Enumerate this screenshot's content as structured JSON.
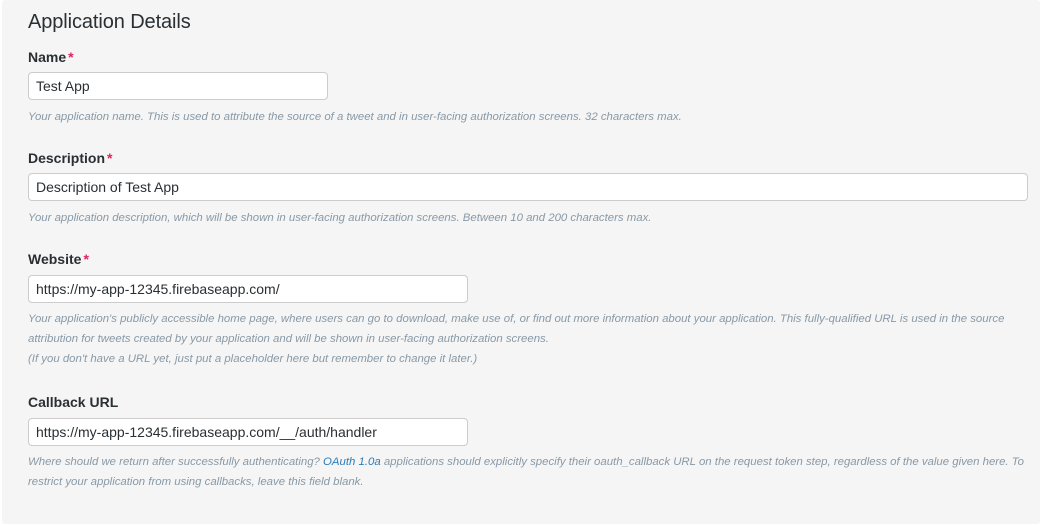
{
  "section": {
    "title": "Application Details"
  },
  "fields": {
    "name": {
      "label": "Name",
      "required_mark": "*",
      "value": "Test App",
      "help": "Your application name. This is used to attribute the source of a tweet and in user-facing authorization screens. 32 characters max."
    },
    "description": {
      "label": "Description",
      "required_mark": "*",
      "value": "Description of Test App",
      "help": "Your application description, which will be shown in user-facing authorization screens. Between 10 and 200 characters max."
    },
    "website": {
      "label": "Website",
      "required_mark": "*",
      "value": "https://my-app-12345.firebaseapp.com/",
      "help_line1": "Your application's publicly accessible home page, where users can go to download, make use of, or find out more information about your application. This fully-qualified URL is used in the source attribution for tweets created by your application and will be shown in user-facing authorization screens.",
      "help_line2": "(If you don't have a URL yet, just put a placeholder here but remember to change it later.)"
    },
    "callback": {
      "label": "Callback URL",
      "value": "https://my-app-12345.firebaseapp.com/__/auth/handler",
      "help_before_link": "Where should we return after successfully authenticating? ",
      "help_link": "OAuth 1.0a",
      "help_after_link": " applications should explicitly specify their oauth_callback URL on the request token step, regardless of the value given here. To restrict your application from using callbacks, leave this field blank."
    }
  },
  "colors": {
    "panel_background": "#f5f5f5",
    "required": "#e0245e",
    "help_text": "#8899a6",
    "link": "#2b7bb9"
  }
}
